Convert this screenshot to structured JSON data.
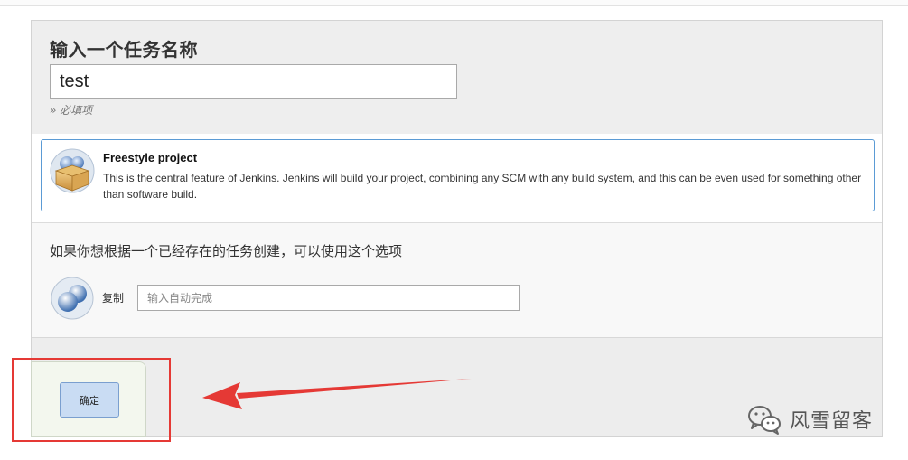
{
  "form": {
    "title": "输入一个任务名称",
    "job_name_value": "test",
    "required_note": "» 必填项"
  },
  "job_types": [
    {
      "name": "Freestyle project",
      "description": "This is the central feature of Jenkins. Jenkins will build your project, combining any SCM with any build system, and this can be even used for something other than software build.",
      "icon": "freestyle-box-icon",
      "selected": true
    }
  ],
  "copy": {
    "hint": "如果你想根据一个已经存在的任务创建，可以使用这个选项",
    "label": "复制",
    "placeholder": "输入自动完成",
    "icon": "copy-job-icon"
  },
  "actions": {
    "ok_label": "确定"
  },
  "annotation": {
    "color": "#e53935",
    "arrow": "arrow-pointing-left-icon"
  },
  "watermark": {
    "text": "风雪留客",
    "icon": "wechat-icon"
  },
  "colors": {
    "card_border": "#5b9bd5",
    "ok_button_bg": "#c9dcf3"
  }
}
